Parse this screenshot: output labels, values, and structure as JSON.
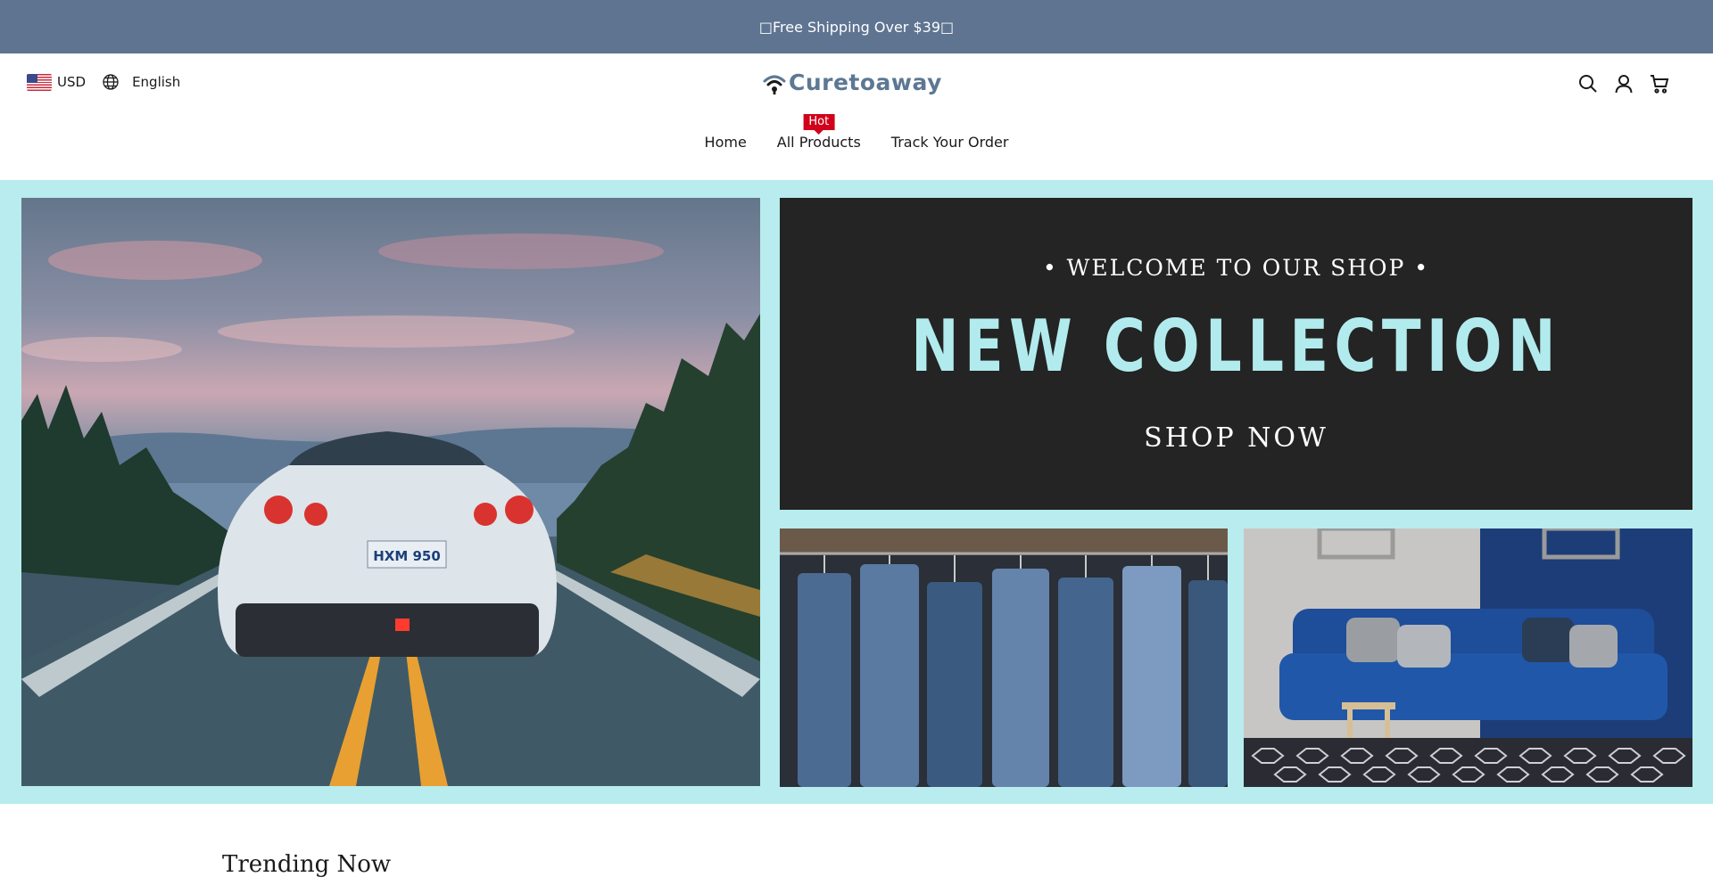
{
  "announcement": {
    "text": "□Free Shipping Over $39□"
  },
  "header": {
    "currency": "USD",
    "currency_flag_icon": "us-flag-icon",
    "language": "English",
    "language_icon": "globe-icon",
    "logo_text": "Curetoaway",
    "icons": [
      "search-icon",
      "account-icon",
      "cart-icon"
    ]
  },
  "nav": {
    "items": [
      {
        "label": "Home"
      },
      {
        "label": "All Products",
        "badge": "Hot"
      },
      {
        "label": "Track Your Order"
      }
    ]
  },
  "banner": {
    "collection": {
      "welcome": "• WELCOME TO OUR SHOP •",
      "headline": "NEW COLLECTION",
      "cta": "SHOP NOW"
    },
    "plate_text": "HXM 950",
    "colors": {
      "background": "#b8ecee",
      "collection_bg": "#232423",
      "headline": "#b2ebee"
    }
  },
  "sections": {
    "trending_title": "Trending Now"
  },
  "colors": {
    "announcement_bg": "#5e7491",
    "logo": "#5d7893",
    "hot_badge": "#d0021b"
  }
}
